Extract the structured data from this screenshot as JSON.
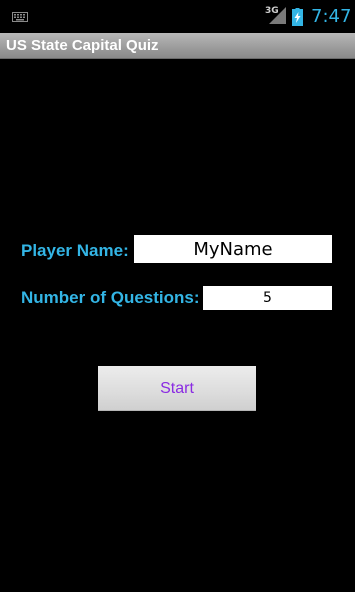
{
  "statusbar": {
    "keyboard_icon": "keyboard-icon",
    "network_label": "3G",
    "signal_icon": "signal-icon",
    "battery_icon": "battery-charging-icon",
    "time": "7:47",
    "time_color": "#33b5e5"
  },
  "titlebar": {
    "title": "US State Capital Quiz"
  },
  "form": {
    "player_name_label": "Player Name:",
    "player_name_value": "MyName",
    "num_questions_label": "Number of Questions:",
    "num_questions_value": "5",
    "label_color": "#33b5e5"
  },
  "actions": {
    "start_label": "Start",
    "start_text_color": "#8a2be2"
  }
}
